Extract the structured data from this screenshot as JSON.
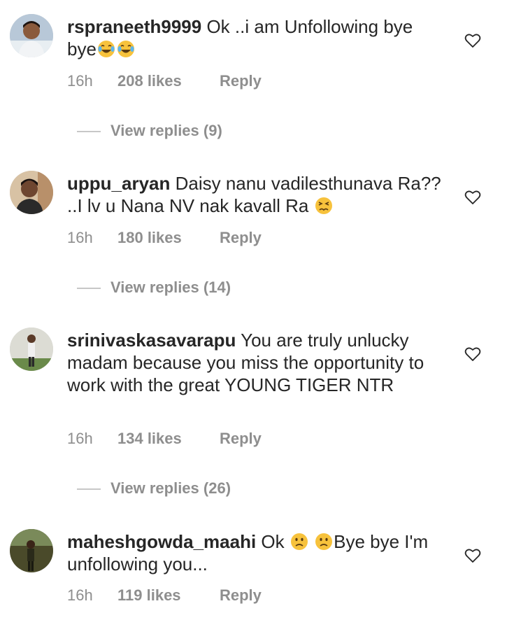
{
  "comments": [
    {
      "username": "rspraneeth9999",
      "text_before": " Ok ..i am Unfollowing bye bye",
      "emojis_after": [
        "face-with-tears-of-joy",
        "face-with-tears-of-joy"
      ],
      "text_after": "",
      "time": "16h",
      "likes": "208 likes",
      "reply": "Reply",
      "view_replies": "View replies (9)"
    },
    {
      "username": "uppu_aryan",
      "text_before": " Daisy nanu vadilesthunava Ra?? ..I lv u Nana NV nak kavall Ra ",
      "emojis_after": [
        "persevering-face"
      ],
      "text_after": "",
      "time": "16h",
      "likes": "180 likes",
      "reply": "Reply",
      "view_replies": "View replies (14)"
    },
    {
      "username": "srinivaskasavarapu",
      "text_before": " You are truly unlucky madam because you miss the opportunity to work with the great YOUNG TIGER NTR",
      "emojis_after": [],
      "text_after": "",
      "time": "16h",
      "likes": "134 likes",
      "reply": "Reply",
      "view_replies": "View replies (26)"
    },
    {
      "username": "maheshgowda_maahi",
      "text_before": " Ok ",
      "emojis_after": [
        "slightly-frowning-face",
        "slightly-frowning-face"
      ],
      "text_after": "Bye bye I'm unfollowing you...",
      "time": "16h",
      "likes": "119 likes",
      "reply": "Reply",
      "view_replies": ""
    }
  ],
  "colors": {
    "text": "#262626",
    "meta": "#8e8e8e",
    "divider": "#c7c7c7",
    "heart_stroke": "#262626",
    "emoji_face": "#f7c23c"
  },
  "icons": {
    "like": "heart-outline-icon"
  }
}
